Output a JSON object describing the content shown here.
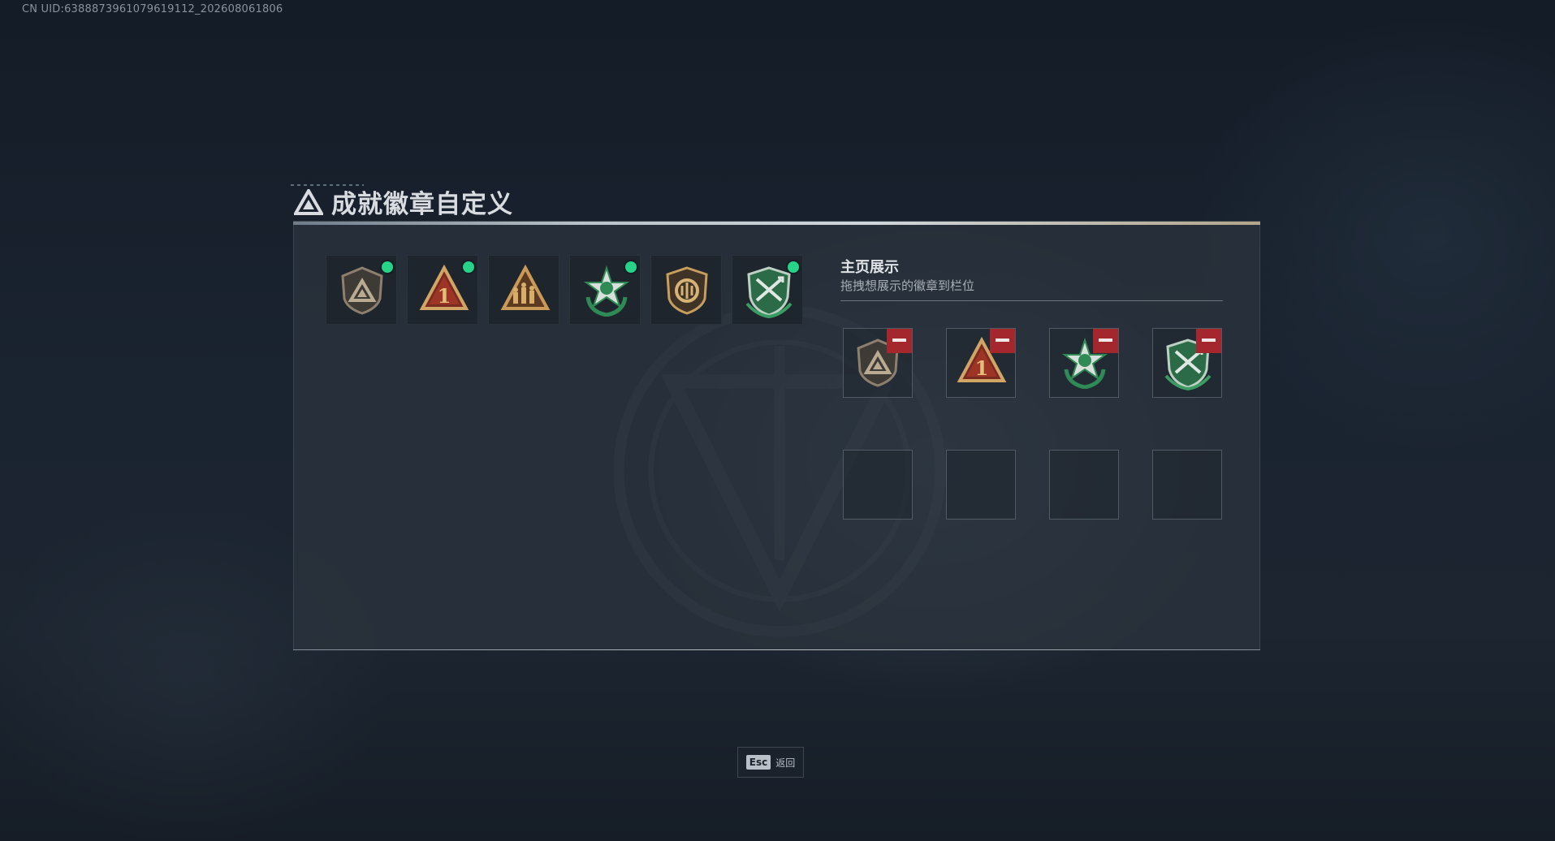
{
  "uid_text": "CN UID:6388873961079619112_202608061806",
  "title": "成就徽章自定义",
  "badges": [
    {
      "icon": "bronze-triangle-shield-badge-icon",
      "new": true
    },
    {
      "icon": "number-one-triangle-badge-icon",
      "new": true
    },
    {
      "icon": "soldiers-triangle-badge-icon",
      "new": false
    },
    {
      "icon": "green-star-wreath-badge-icon",
      "new": true
    },
    {
      "icon": "gold-crest-shield-badge-icon",
      "new": false
    },
    {
      "icon": "green-crossed-arrows-shield-badge-icon",
      "new": true
    }
  ],
  "showcase": {
    "title": "主页展示",
    "subtitle": "拖拽想展示的徽章到栏位",
    "slots": [
      {
        "icon": "bronze-triangle-shield-badge-icon",
        "filled": true
      },
      {
        "icon": "number-one-triangle-badge-icon",
        "filled": true
      },
      {
        "icon": "green-star-wreath-badge-icon",
        "filled": true
      },
      {
        "icon": "green-crossed-arrows-shield-badge-icon",
        "filled": true
      },
      {
        "filled": false
      },
      {
        "filled": false
      },
      {
        "filled": false
      },
      {
        "filled": false
      }
    ]
  },
  "footer": {
    "key": "Esc",
    "label": "返回"
  },
  "colors": {
    "new_dot": "#27d289",
    "remove": "#a3272c",
    "accent_gold": "#c9a36a",
    "accent_green": "#2f8a55"
  }
}
